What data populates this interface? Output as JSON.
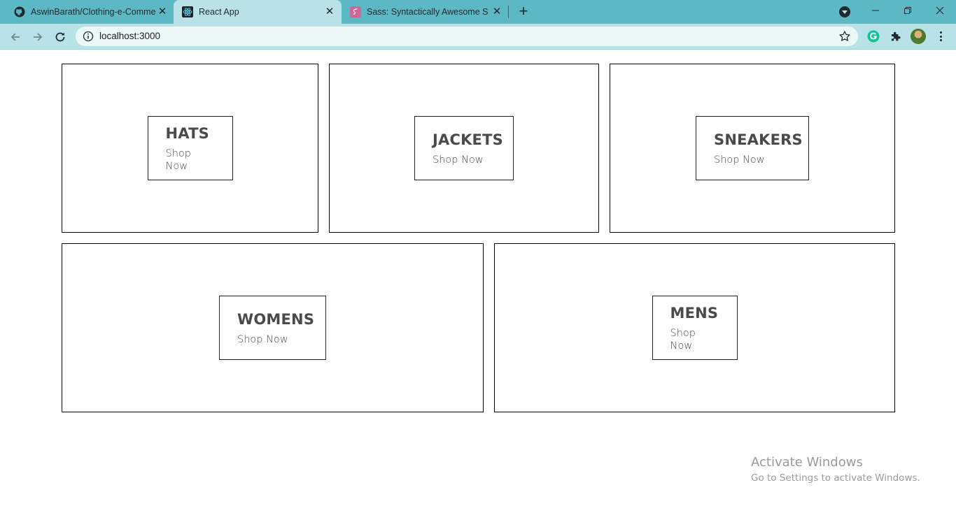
{
  "browser": {
    "tabs": [
      {
        "title": "AswinBarath/Clothing-e-Commerce",
        "icon": "github-icon",
        "active": false
      },
      {
        "title": "React App",
        "icon": "react-icon",
        "active": true
      },
      {
        "title": "Sass: Syntactically Awesome Style Sheets",
        "icon": "sass-icon",
        "active": false
      }
    ],
    "address_bar": {
      "url": "localhost:3000"
    },
    "colors": {
      "tab_strip": "#5bb8c4",
      "toolbar": "#b9e2e7"
    }
  },
  "directory": {
    "items": [
      {
        "title": "HATS",
        "subtitle": "Shop Now"
      },
      {
        "title": "JACKETS",
        "subtitle": "Shop Now"
      },
      {
        "title": "SNEAKERS",
        "subtitle": "Shop Now"
      },
      {
        "title": "WOMENS",
        "subtitle": "Shop Now"
      },
      {
        "title": "MENS",
        "subtitle": "Shop Now"
      }
    ]
  },
  "watermark": {
    "line1": "Activate Windows",
    "line2": "Go to Settings to activate Windows."
  }
}
